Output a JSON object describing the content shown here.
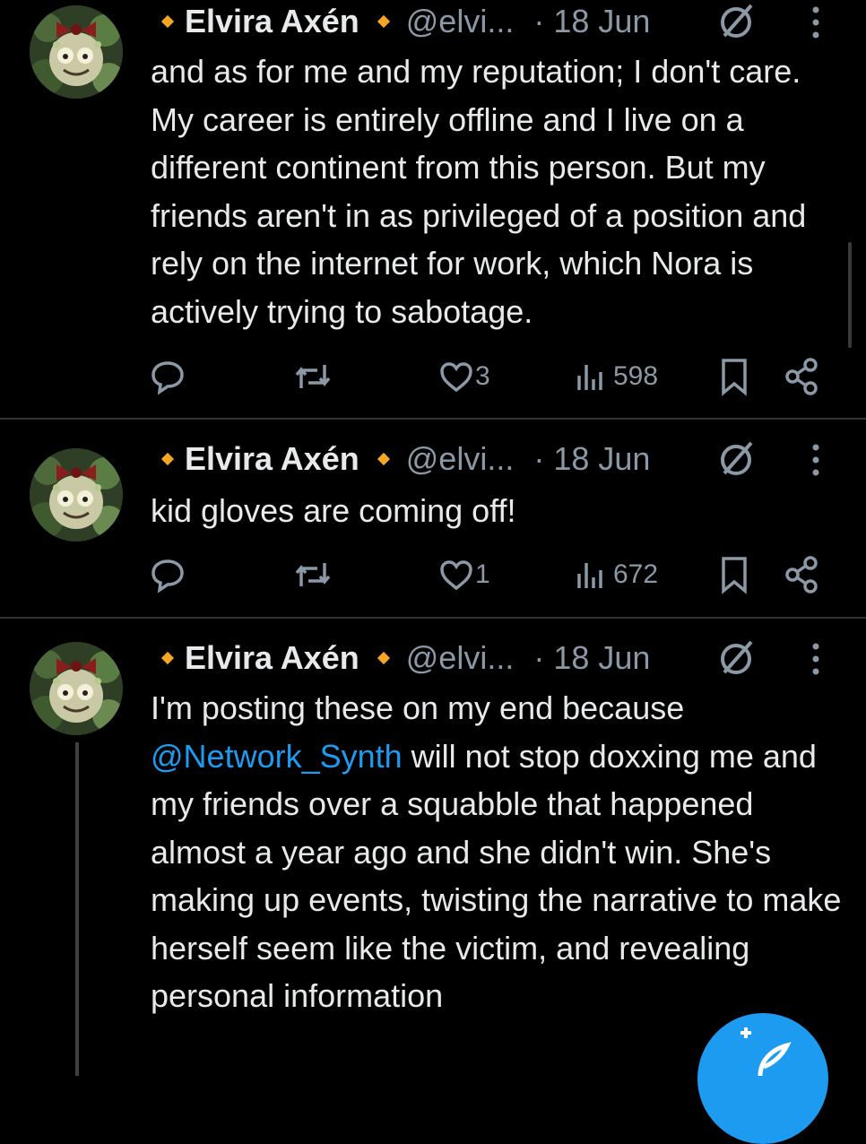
{
  "tweets": [
    {
      "name": "Elvira Axén",
      "handle": "@elvi...",
      "date": "· 18 Jun",
      "text": "and as for me and my reputation; I don't care. My career is entirely offline and I live on a different continent from this person. But my friends aren't in as privileged of a position and rely on the internet for work, which Nora is actively trying to sabotage.",
      "likes": "3",
      "views": "598"
    },
    {
      "name": "Elvira Axén",
      "handle": "@elvi...",
      "date": "· 18 Jun",
      "text": "kid gloves are coming off!",
      "likes": "1",
      "views": "672"
    },
    {
      "name": "Elvira Axén",
      "handle": "@elvi...",
      "date": "· 18 Jun",
      "mention": "@Network_Synth",
      "text_before": "I'm posting these on my end because",
      "text_after": "will not stop doxxing me and my friends over a squabble that happened almost a year ago and she didn't win. She's making up events, twisting the narrative to make herself seem like the victim, and revealing personal information"
    }
  ],
  "colors": {
    "background": "#000000",
    "text": "#e7e9ea",
    "secondary": "#8b98a5",
    "accent": "#1d9bf0",
    "badge": "#f5a623",
    "divider": "#2f3336"
  },
  "icons": [
    "reply-icon",
    "retweet-icon",
    "like-icon",
    "views-icon",
    "bookmark-icon",
    "share-icon",
    "no-entry-icon",
    "more-icon",
    "compose-icon"
  ]
}
